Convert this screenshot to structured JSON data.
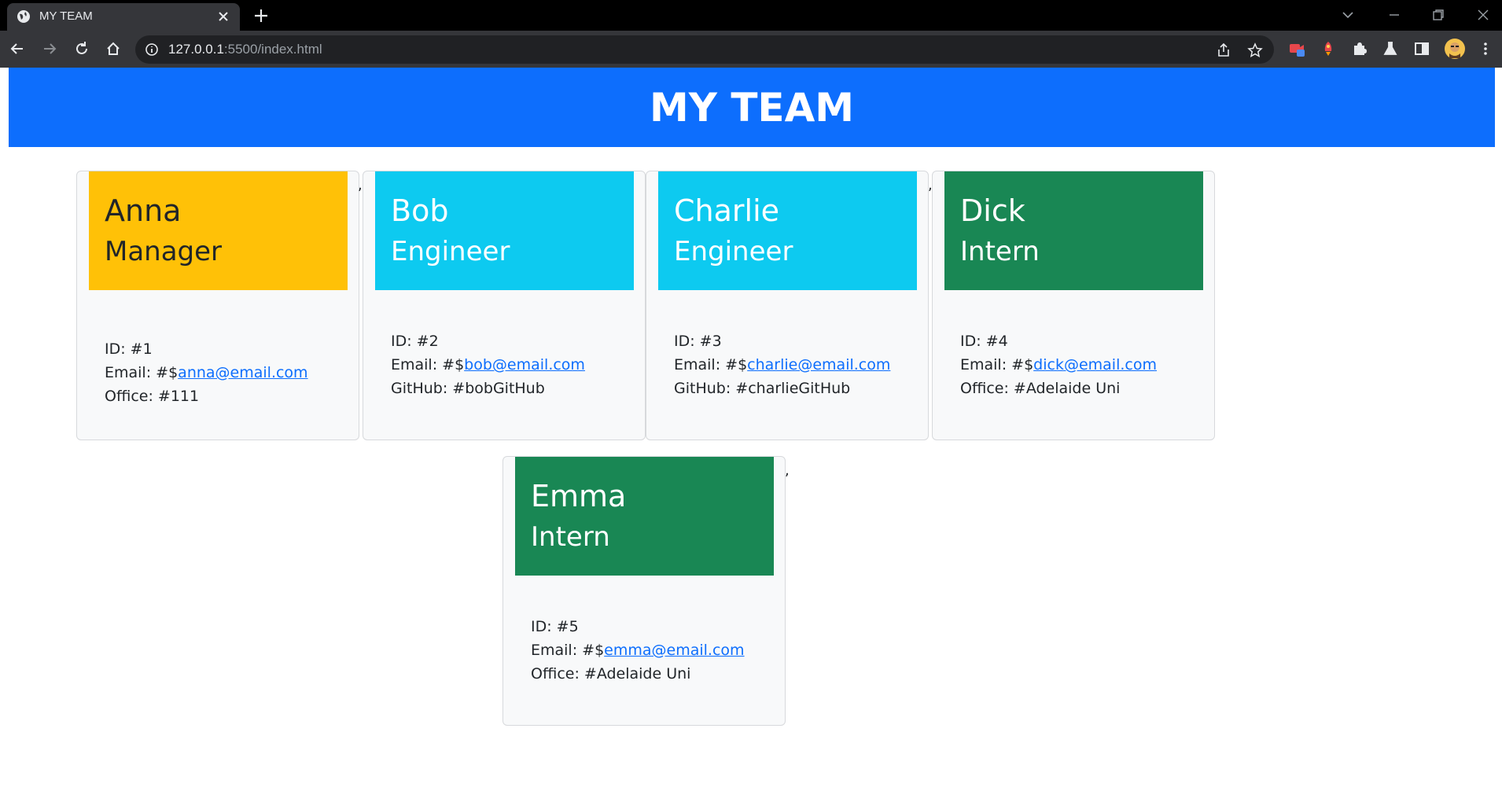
{
  "browser": {
    "tab_title": "MY TEAM",
    "url_host": "127.0.0.1",
    "url_rest": ":5500/index.html"
  },
  "page": {
    "heading": "MY TEAM",
    "separator": ","
  },
  "employees": [
    {
      "name": "Anna",
      "role": "Manager",
      "id": "ID: #1",
      "email_prefix": "Email: #$",
      "email": "anna@email.com",
      "extra": "Office: #111",
      "color": "#ffc107"
    },
    {
      "name": "Bob",
      "role": "Engineer",
      "id": "ID: #2",
      "email_prefix": "Email: #$",
      "email": "bob@email.com",
      "extra": "GitHub: #bobGitHub",
      "color": "#0dcaf0"
    },
    {
      "name": "Charlie",
      "role": "Engineer",
      "id": "ID: #3",
      "email_prefix": "Email: #$",
      "email": "charlie@email.com",
      "extra": "GitHub: #charlieGitHub",
      "color": "#0dcaf0"
    },
    {
      "name": "Dick",
      "role": "Intern",
      "id": "ID: #4",
      "email_prefix": "Email: #$",
      "email": "dick@email.com",
      "extra": "Office: #Adelaide Uni",
      "color": "#198754"
    },
    {
      "name": "Emma",
      "role": "Intern",
      "id": "ID: #5",
      "email_prefix": "Email: #$",
      "email": "emma@email.com",
      "extra": "Office: #Adelaide Uni",
      "color": "#198754"
    }
  ],
  "colors": {
    "jumbotron": "#0d6efd",
    "manager": "#ffc107",
    "engineer": "#0dcaf0",
    "intern": "#198754"
  }
}
